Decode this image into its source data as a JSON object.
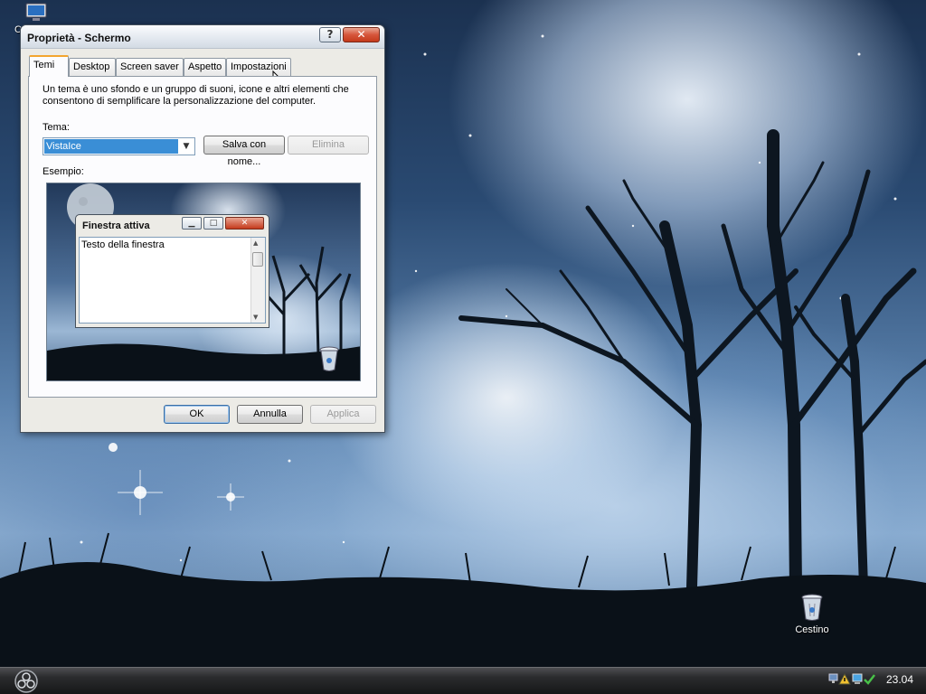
{
  "desktop": {
    "icons": [
      {
        "label": "C",
        "icon": "my-computer-icon"
      },
      {
        "label": "Cestino",
        "icon": "recycle-bin-icon"
      }
    ]
  },
  "dialog": {
    "title": "Proprietà - Schermo",
    "help_label": "?",
    "close_label": "✕",
    "tabs": [
      {
        "label": "Temi",
        "active": true
      },
      {
        "label": "Desktop"
      },
      {
        "label": "Screen saver"
      },
      {
        "label": "Aspetto"
      },
      {
        "label": "Impostazioni"
      }
    ],
    "description": "Un tema è uno sfondo e un gruppo di suoni, icone e altri elementi che consentono di semplificare la personalizzazione del computer.",
    "theme_label": "Tema:",
    "theme_value": "VistaIce",
    "save_as_label": "Salva con nome...",
    "delete_label": "Elimina",
    "sample_label": "Esempio:",
    "preview": {
      "window_title": "Finestra attiva",
      "window_text": "Testo della finestra"
    },
    "ok_label": "OK",
    "cancel_label": "Annulla",
    "apply_label": "Applica"
  },
  "taskbar": {
    "clock": "23.04"
  },
  "colors": {
    "accent_selection": "#3a8ed6",
    "active_tab_highlight": "#f3a52f",
    "close_button": "#c43a1c"
  }
}
